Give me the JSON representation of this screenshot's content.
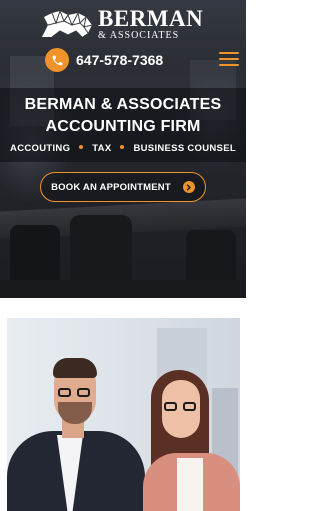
{
  "brand": {
    "name": "BERMAN",
    "sub": "& ASSOCIATES",
    "logo_icon": "lion-icon"
  },
  "header": {
    "phone": "647-578-7368",
    "phone_icon": "phone-icon",
    "menu_icon": "hamburger-menu-icon"
  },
  "hero": {
    "title_line1": "BERMAN & ASSOCIATES",
    "title_line2": "ACCOUNTING FIRM",
    "services": [
      "ACCOUTING",
      "TAX",
      "BUSINESS COUNSEL"
    ],
    "cta_label": "BOOK AN APPOINTMENT",
    "cta_icon": "arrow-right-icon"
  },
  "colors": {
    "accent": "#f0932b",
    "text": "#ffffff"
  }
}
